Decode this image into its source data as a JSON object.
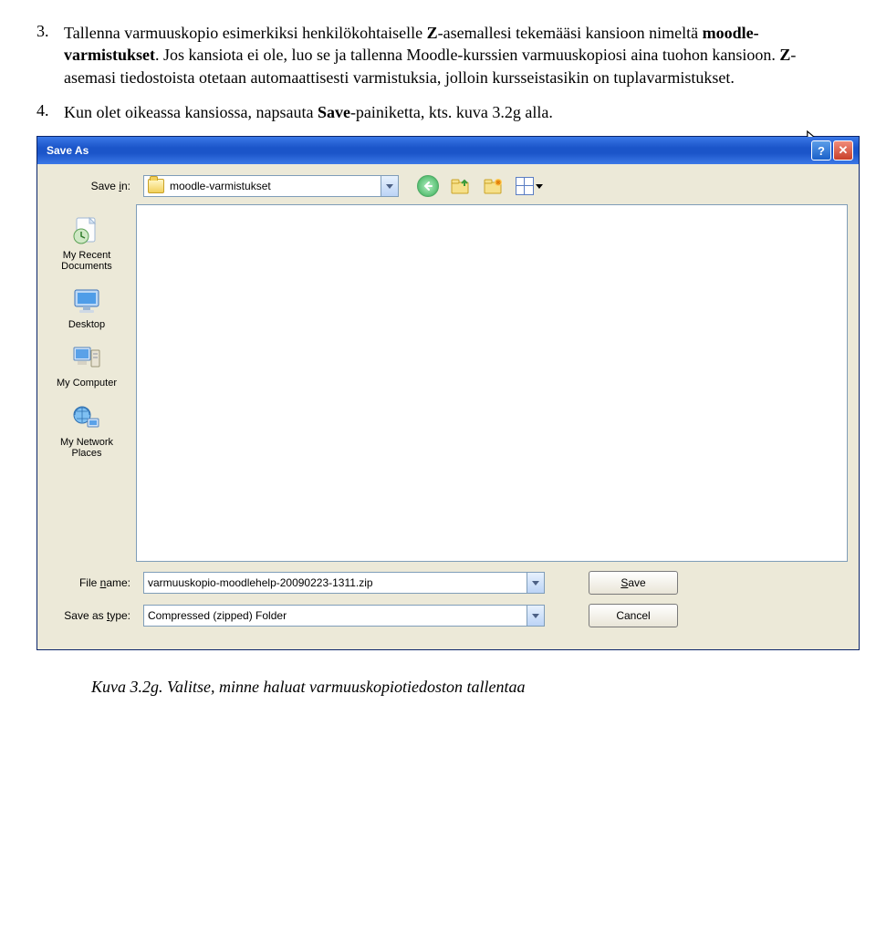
{
  "list": {
    "item3": {
      "num": "3.",
      "pre": "Tallenna varmuuskopio esimerkiksi henkilökohtaiselle ",
      "bold1": "Z",
      "mid1": "-asemallesi tekemääsi kansioon nimeltä ",
      "bold2": "moodle-varmistukset",
      "mid2": ". Jos kansiota ei ole, luo se ja tallenna Moodle-kurssien varmuuskopiosi aina tuohon kansioon. ",
      "bold3": "Z",
      "tail": "-asemasi tiedostoista otetaan automaattisesti varmistuksia, jolloin kursseistasikin on tuplavarmistukset."
    },
    "item4": {
      "num": "4.",
      "pre": "Kun olet oikeassa kansiossa, napsauta ",
      "bold1": "Save",
      "tail": "-painiketta, kts. kuva 3.2g alla."
    }
  },
  "dialog": {
    "title": "Save As",
    "savein_pre": "Save ",
    "savein_u": "i",
    "savein_post": "n:",
    "folder": "moodle-varmistukset",
    "places": {
      "recent": "My Recent Documents",
      "desktop": "Desktop",
      "computer": "My Computer",
      "network": "My Network Places"
    },
    "filename_pre": "File ",
    "filename_u": "n",
    "filename_post": "ame:",
    "filename_value": "varmuuskopio-moodlehelp-20090223-1311.zip",
    "type_pre": "Save as ",
    "type_u": "t",
    "type_post": "ype:",
    "type_value": "Compressed (zipped) Folder",
    "save_u": "S",
    "save_rest": "ave",
    "cancel": "Cancel"
  },
  "caption": "Kuva 3.2g. Valitse, minne haluat varmuuskopiotiedoston tallentaa"
}
